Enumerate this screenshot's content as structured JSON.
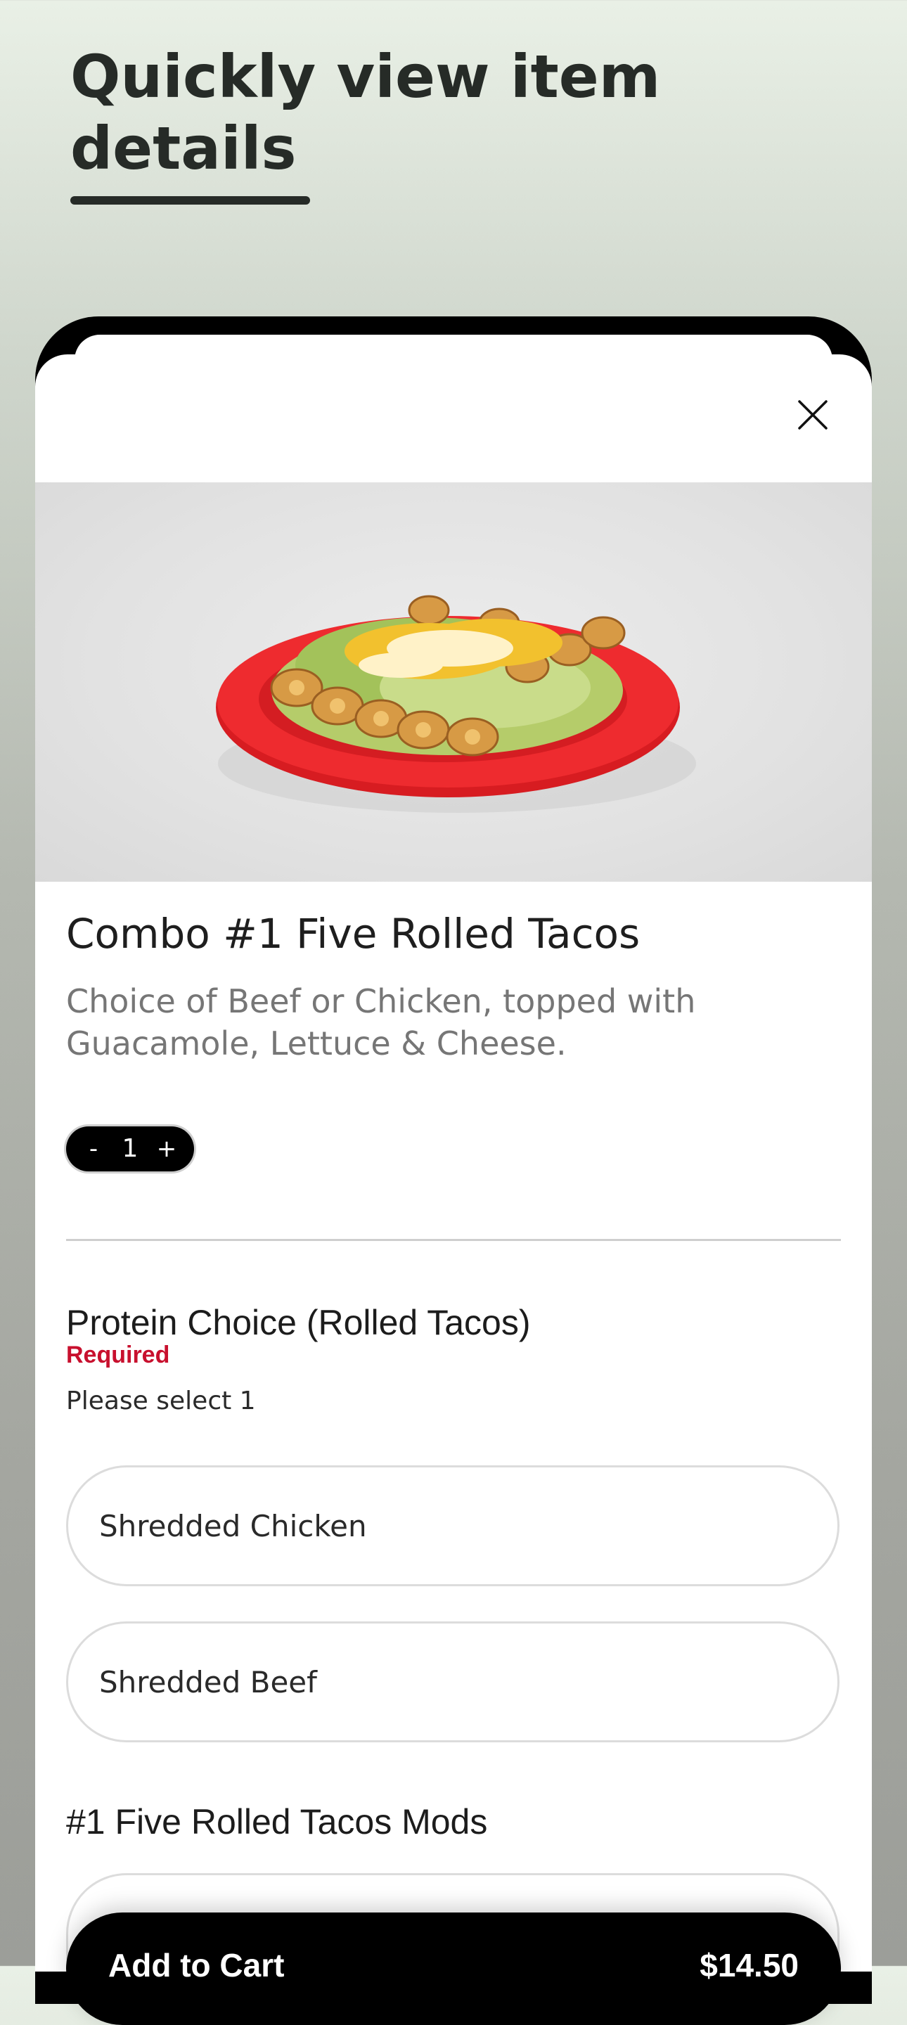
{
  "headline": {
    "line1": "Quickly view item",
    "line2": "details"
  },
  "item": {
    "title": "Combo #1 Five Rolled Tacos",
    "description_line1": "Choice of Beef or Chicken, topped with",
    "description_line2": "Guacamole, Lettuce & Cheese."
  },
  "quantity": {
    "minus_label": "-",
    "value": "1",
    "plus_label": "+"
  },
  "protein_group": {
    "title": "Protein Choice (Rolled Tacos)",
    "required_label": "Required",
    "hint": "Please select 1",
    "options": [
      {
        "label": "Shredded Chicken"
      },
      {
        "label": "Shredded Beef"
      }
    ]
  },
  "mods_group": {
    "title": "#1 Five Rolled Tacos Mods"
  },
  "cart": {
    "label": "Add to Cart",
    "price": "$14.50"
  },
  "colors": {
    "accent_required": "#c8102e",
    "cart_bar": "#000000",
    "plate": "#e8262a"
  },
  "icons": {
    "close": "close-icon",
    "food": "rolled-tacos-photo"
  }
}
